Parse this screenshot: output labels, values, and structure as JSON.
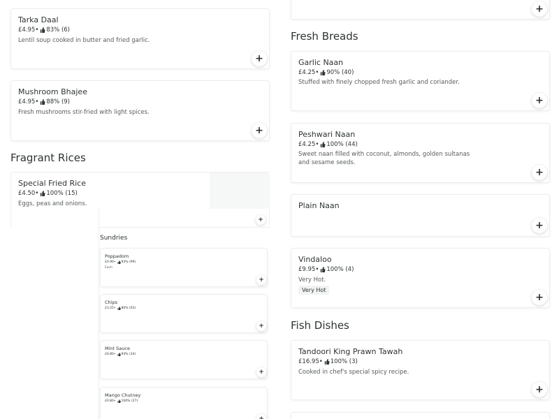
{
  "left": {
    "tarka": {
      "name": "Tarka Daal",
      "price": "£4.95",
      "rating": "83% (6)",
      "desc": "Lentil soup cooked in butter and fried garlic."
    },
    "mushroom": {
      "name": "Mushroom Bhajee",
      "price": "£4.95",
      "rating": "88% (9)",
      "desc": "Fresh mushrooms stir-fried with light spices."
    },
    "fragrant_title": "Fragrant Rices",
    "special": {
      "name": "Special Fried Rice",
      "price": "£4.50",
      "rating": "100% (15)",
      "desc": "Eggs, peas and onions."
    }
  },
  "sundries": {
    "title": "Sundries",
    "items": [
      {
        "name": "Poppadom",
        "price": "£0.90",
        "rating": "93% (99)",
        "desc": "Each"
      },
      {
        "name": "Chips",
        "price": "£3.25",
        "rating": "80% (63)",
        "desc": ""
      },
      {
        "name": "Mint Sauce",
        "price": "£0.80",
        "rating": "94% (34)",
        "desc": ""
      },
      {
        "name": "Mango Chutney",
        "price": "£0.80",
        "rating": "100% (27)",
        "desc": ""
      }
    ]
  },
  "right": {
    "fresh_title": "Fresh Breads",
    "garlic": {
      "name": "Garlic Naan",
      "price": "£4.25",
      "rating": "90% (40)",
      "desc": "Stuffed with finely chopped fresh garlic and coriander."
    },
    "peshwari": {
      "name": "Peshwari Naan",
      "price": "£4.25",
      "rating": "100% (44)",
      "desc": "Sweet naan filled with coconut, almonds, golden sultanas and sesame seeds."
    },
    "plain": {
      "name": "Plain Naan"
    },
    "vindaloo": {
      "name": "Vindaloo",
      "price": "£9.95",
      "rating": "100% (4)",
      "desc": "Very Hot.",
      "badge": "Very Hot"
    },
    "fish_title": "Fish Dishes",
    "tandoori": {
      "name": "Tandoori King Prawn Tawah",
      "price": "£16.95",
      "rating": "100% (3)",
      "desc": "Cooked in chef's special spicy recipe."
    }
  },
  "ui": {
    "add_symbol": "+",
    "separator": " • "
  },
  "icons": {
    "rating": "thumbs-up-icon",
    "add": "plus-icon"
  }
}
